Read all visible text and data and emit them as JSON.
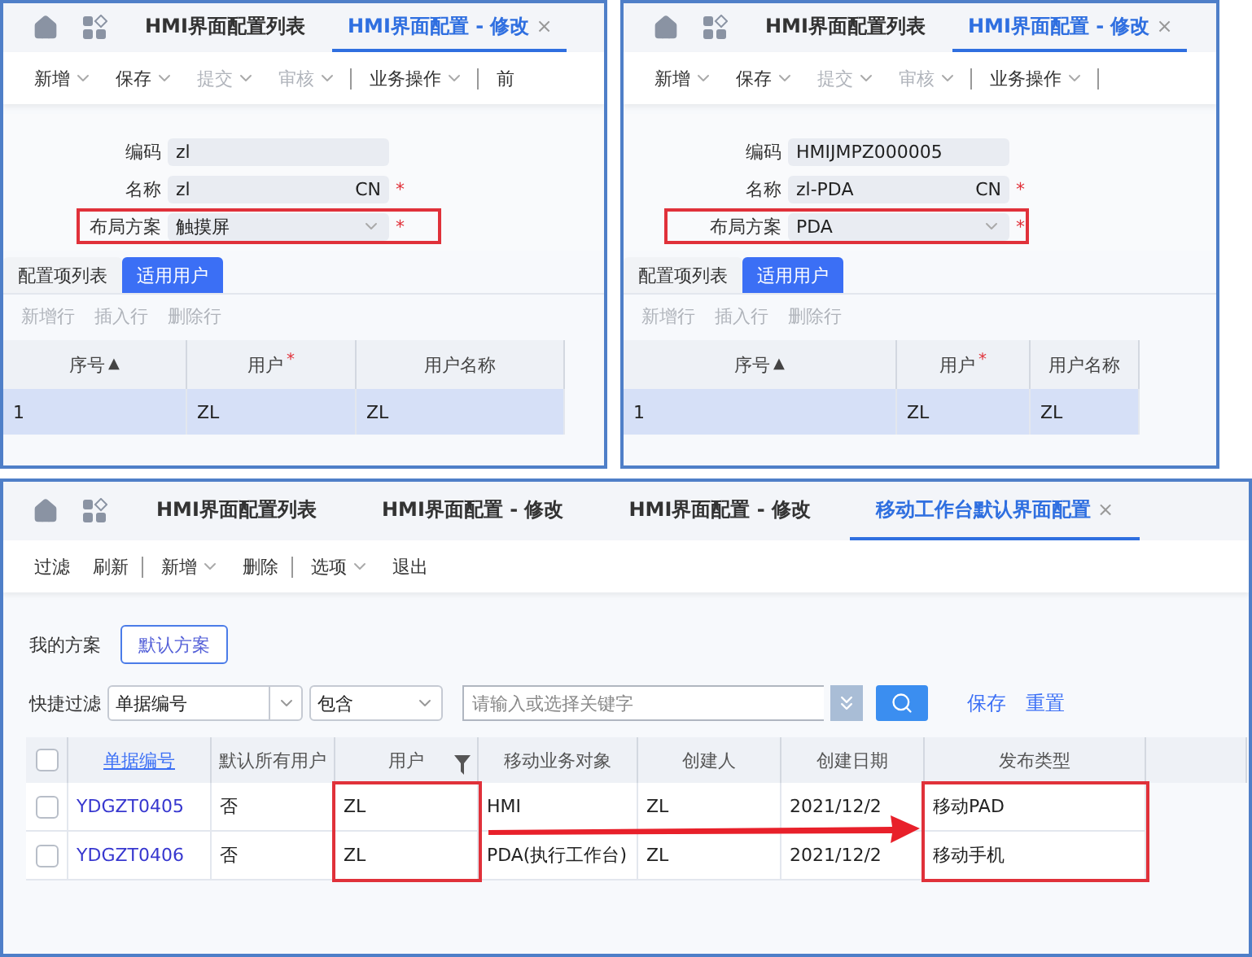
{
  "top_panels": [
    {
      "tabs": [
        {
          "label": "HMI界面配置列表",
          "selected": false
        },
        {
          "label": "HMI界面配置 - 修改",
          "selected": true,
          "close": "×"
        }
      ],
      "toolbar": [
        {
          "label": "新增",
          "dropdown": true,
          "disabled": false,
          "divider_after": false
        },
        {
          "label": "保存",
          "dropdown": true,
          "disabled": false,
          "divider_after": false
        },
        {
          "label": "提交",
          "dropdown": true,
          "disabled": true,
          "divider_after": false
        },
        {
          "label": "审核",
          "dropdown": true,
          "disabled": true,
          "divider_after": true
        },
        {
          "label": "业务操作",
          "dropdown": true,
          "disabled": false,
          "divider_after": true
        },
        {
          "label": "前",
          "dropdown": false,
          "disabled": false,
          "divider_after": false
        }
      ],
      "fields": [
        {
          "label": "编码",
          "value": "zl",
          "dropdown": false,
          "highlighted": false
        },
        {
          "label": "名称",
          "value": "zl",
          "suffix": "CN",
          "required_mark": "*",
          "dropdown": false,
          "highlighted": false
        },
        {
          "label": "布局方案",
          "value": "触摸屏",
          "required_mark": "*",
          "dropdown": true,
          "highlighted": true
        }
      ],
      "subtabs": [
        {
          "label": "配置项列表",
          "selected": false
        },
        {
          "label": "适用用户",
          "selected": true
        }
      ],
      "row_actions": [
        {
          "label": "新增行",
          "disabled": true
        },
        {
          "label": "插入行",
          "disabled": true
        },
        {
          "label": "删除行",
          "disabled": true
        }
      ],
      "table": {
        "columns": [
          {
            "label": "序号",
            "sort_mark": "▲"
          },
          {
            "label": "用户",
            "required_mark": "*"
          },
          {
            "label": "用户名称"
          }
        ],
        "rows": [
          {
            "cells": [
              "1",
              "ZL",
              "ZL"
            ],
            "selected": true
          }
        ]
      }
    },
    {
      "tabs": [
        {
          "label": "HMI界面配置列表",
          "selected": false
        },
        {
          "label": "HMI界面配置 - 修改",
          "selected": true,
          "close": "×"
        }
      ],
      "toolbar": [
        {
          "label": "新增",
          "dropdown": true,
          "disabled": false,
          "divider_after": false
        },
        {
          "label": "保存",
          "dropdown": true,
          "disabled": false,
          "divider_after": false
        },
        {
          "label": "提交",
          "dropdown": true,
          "disabled": true,
          "divider_after": false
        },
        {
          "label": "审核",
          "dropdown": true,
          "disabled": true,
          "divider_after": true
        },
        {
          "label": "业务操作",
          "dropdown": true,
          "disabled": false,
          "divider_after": true
        }
      ],
      "fields": [
        {
          "label": "编码",
          "value": "HMIJMPZ000005",
          "dropdown": false,
          "highlighted": false
        },
        {
          "label": "名称",
          "value": "zl-PDA",
          "suffix": "CN",
          "required_mark": "*",
          "dropdown": false,
          "highlighted": false
        },
        {
          "label": "布局方案",
          "value": "PDA",
          "required_mark": "*",
          "dropdown": true,
          "highlighted": true
        }
      ],
      "subtabs": [
        {
          "label": "配置项列表",
          "selected": false
        },
        {
          "label": "适用用户",
          "selected": true
        }
      ],
      "row_actions": [
        {
          "label": "新增行",
          "disabled": true
        },
        {
          "label": "插入行",
          "disabled": true
        },
        {
          "label": "删除行",
          "disabled": true
        }
      ],
      "table": {
        "columns": [
          {
            "label": "序号",
            "sort_mark": "▲"
          },
          {
            "label": "用户",
            "required_mark": "*"
          },
          {
            "label": "用户名称"
          }
        ],
        "rows": [
          {
            "cells": [
              "1",
              "ZL",
              "ZL"
            ],
            "selected": true
          }
        ]
      }
    }
  ],
  "list_panel": {
    "tabs": [
      {
        "label": "HMI界面配置列表",
        "selected": false
      },
      {
        "label": "HMI界面配置 - 修改",
        "selected": false
      },
      {
        "label": "HMI界面配置 - 修改",
        "selected": false
      },
      {
        "label": "移动工作台默认界面配置",
        "selected": true,
        "close": "×"
      }
    ],
    "toolbar": [
      {
        "label": "过滤",
        "dropdown": false,
        "divider_after": false
      },
      {
        "label": "刷新",
        "dropdown": false,
        "divider_after": true
      },
      {
        "label": "新增",
        "dropdown": true,
        "divider_after": false
      },
      {
        "label": "删除",
        "dropdown": false,
        "divider_after": true
      },
      {
        "label": "选项",
        "dropdown": true,
        "divider_after": false
      },
      {
        "label": "退出",
        "dropdown": false,
        "divider_after": false
      }
    ],
    "scheme": {
      "label": "我的方案",
      "button": "默认方案"
    },
    "quick_filter": {
      "label": "快捷过滤",
      "field": "单据编号",
      "operator": "包含",
      "placeholder": "请输入或选择关键字",
      "save": "保存",
      "reset": "重置"
    },
    "table": {
      "select_all_checked": false,
      "columns": [
        {
          "label": "单据编号",
          "kind": "link",
          "highlighted": false
        },
        {
          "label": "默认所有用户",
          "kind": "text",
          "highlighted": false
        },
        {
          "label": "用户",
          "kind": "text",
          "filter": true,
          "highlighted": true
        },
        {
          "label": "移动业务对象",
          "kind": "text",
          "highlighted": false
        },
        {
          "label": "创建人",
          "kind": "text",
          "highlighted": false
        },
        {
          "label": "创建日期",
          "kind": "text",
          "highlighted": false
        },
        {
          "label": "发布类型",
          "kind": "text",
          "highlighted": true
        }
      ],
      "rows": [
        {
          "checked": false,
          "cells": [
            "YDGZT0405",
            "否",
            "ZL",
            "HMI",
            "ZL",
            "2021/12/2",
            "移动PAD"
          ]
        },
        {
          "checked": false,
          "cells": [
            "YDGZT0406",
            "否",
            "ZL",
            "PDA(执行工作台)",
            "ZL",
            "2021/12/2",
            "移动手机"
          ]
        }
      ]
    },
    "annotation_arrow": true
  }
}
